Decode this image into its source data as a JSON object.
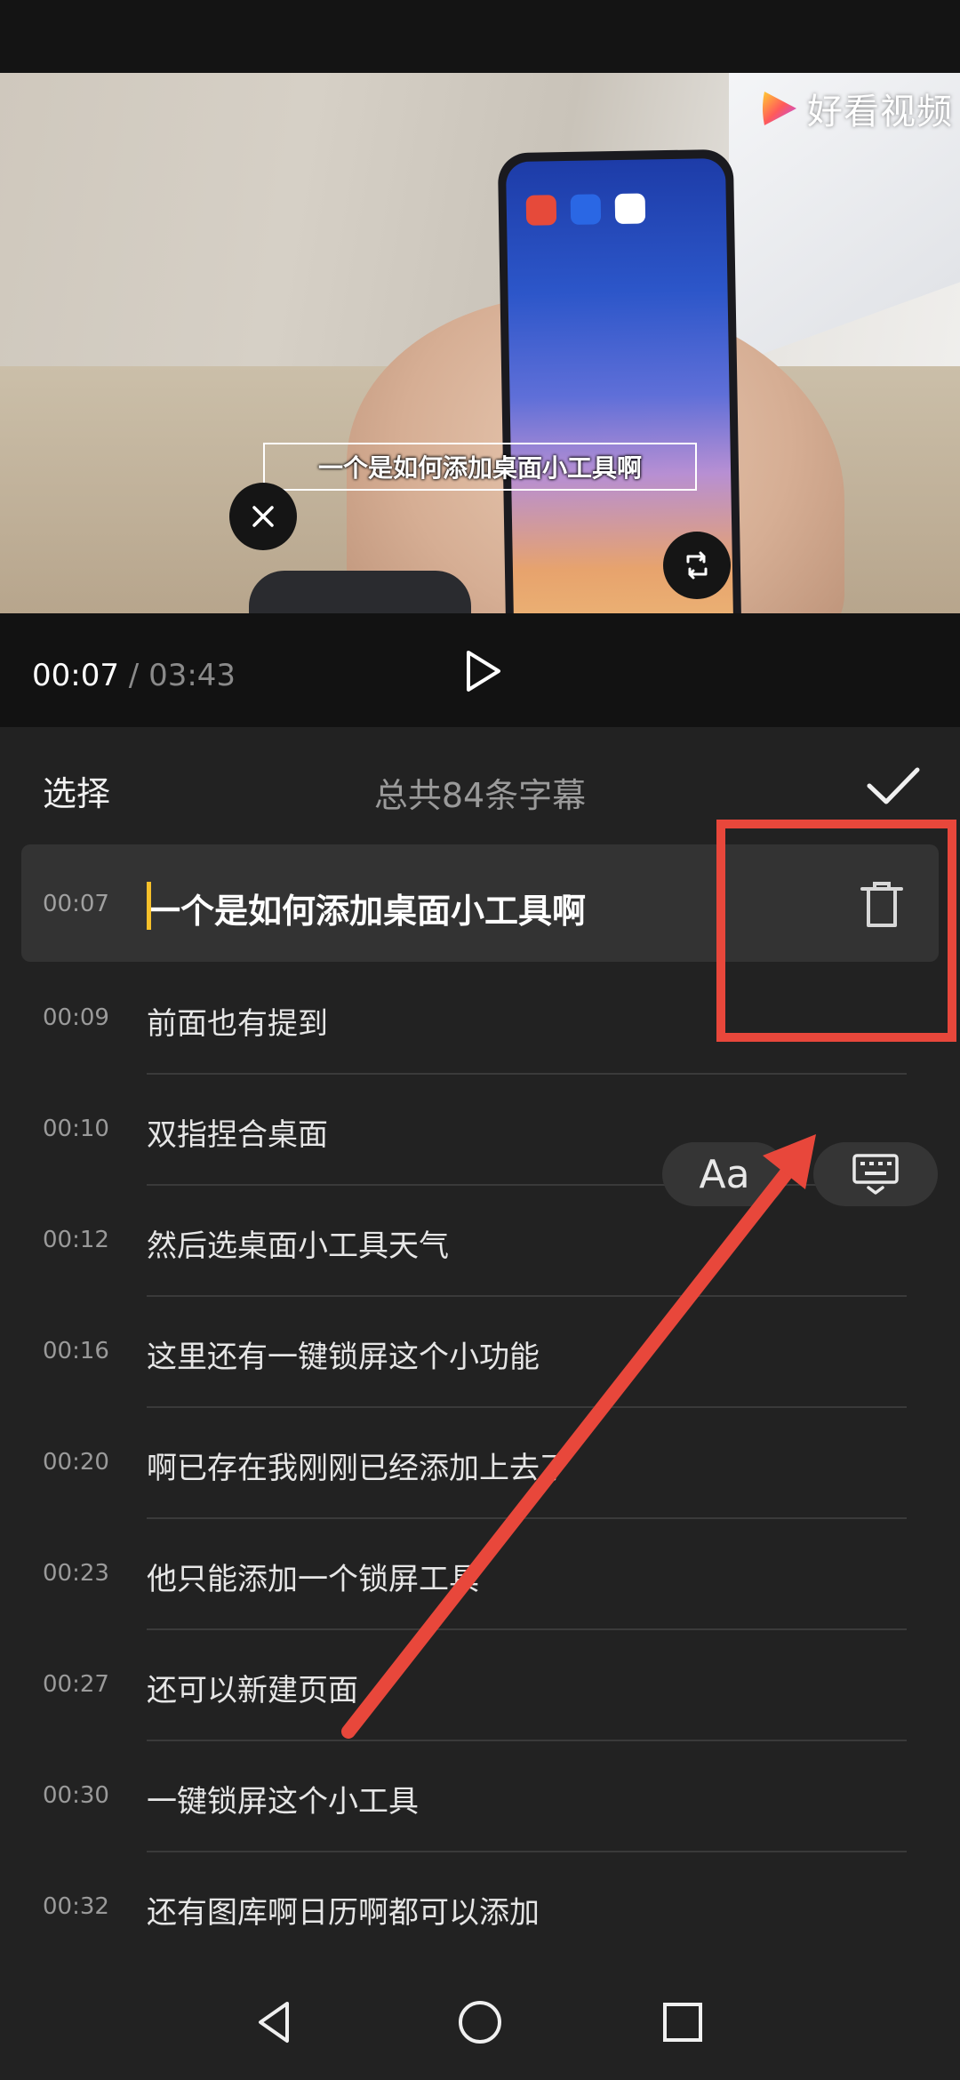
{
  "brand": {
    "name": "好看视频"
  },
  "video": {
    "caption": "一个是如何添加桌面小工具啊",
    "current_time": "00:07",
    "separator": "/",
    "total_time": "03:43"
  },
  "header": {
    "select_label": "选择",
    "title": "总共84条字幕"
  },
  "subtitles": [
    {
      "time": "00:07",
      "text": "一个是如何添加桌面小工具啊",
      "active": true
    },
    {
      "time": "00:09",
      "text": "前面也有提到"
    },
    {
      "time": "00:10",
      "text": "双指捏合桌面"
    },
    {
      "time": "00:12",
      "text": "然后选桌面小工具天气"
    },
    {
      "time": "00:16",
      "text": "这里还有一键锁屏这个小功能"
    },
    {
      "time": "00:20",
      "text": "啊已存在我刚刚已经添加上去了"
    },
    {
      "time": "00:23",
      "text": "他只能添加一个锁屏工具"
    },
    {
      "time": "00:27",
      "text": "还可以新建页面"
    },
    {
      "time": "00:30",
      "text": "一键锁屏这个小工具"
    },
    {
      "time": "00:32",
      "text": "还有图库啊日历啊都可以添加"
    }
  ],
  "tools": {
    "font_label": "Aa"
  },
  "colors": {
    "accent_cursor": "#f6c02a",
    "annotation_red": "#e8473b",
    "background": "#222222"
  },
  "icons": [
    "close-icon",
    "rotate-icon",
    "play-icon",
    "check-icon",
    "trash-icon",
    "keyboard-icon",
    "back-icon",
    "home-icon",
    "recents-icon"
  ]
}
